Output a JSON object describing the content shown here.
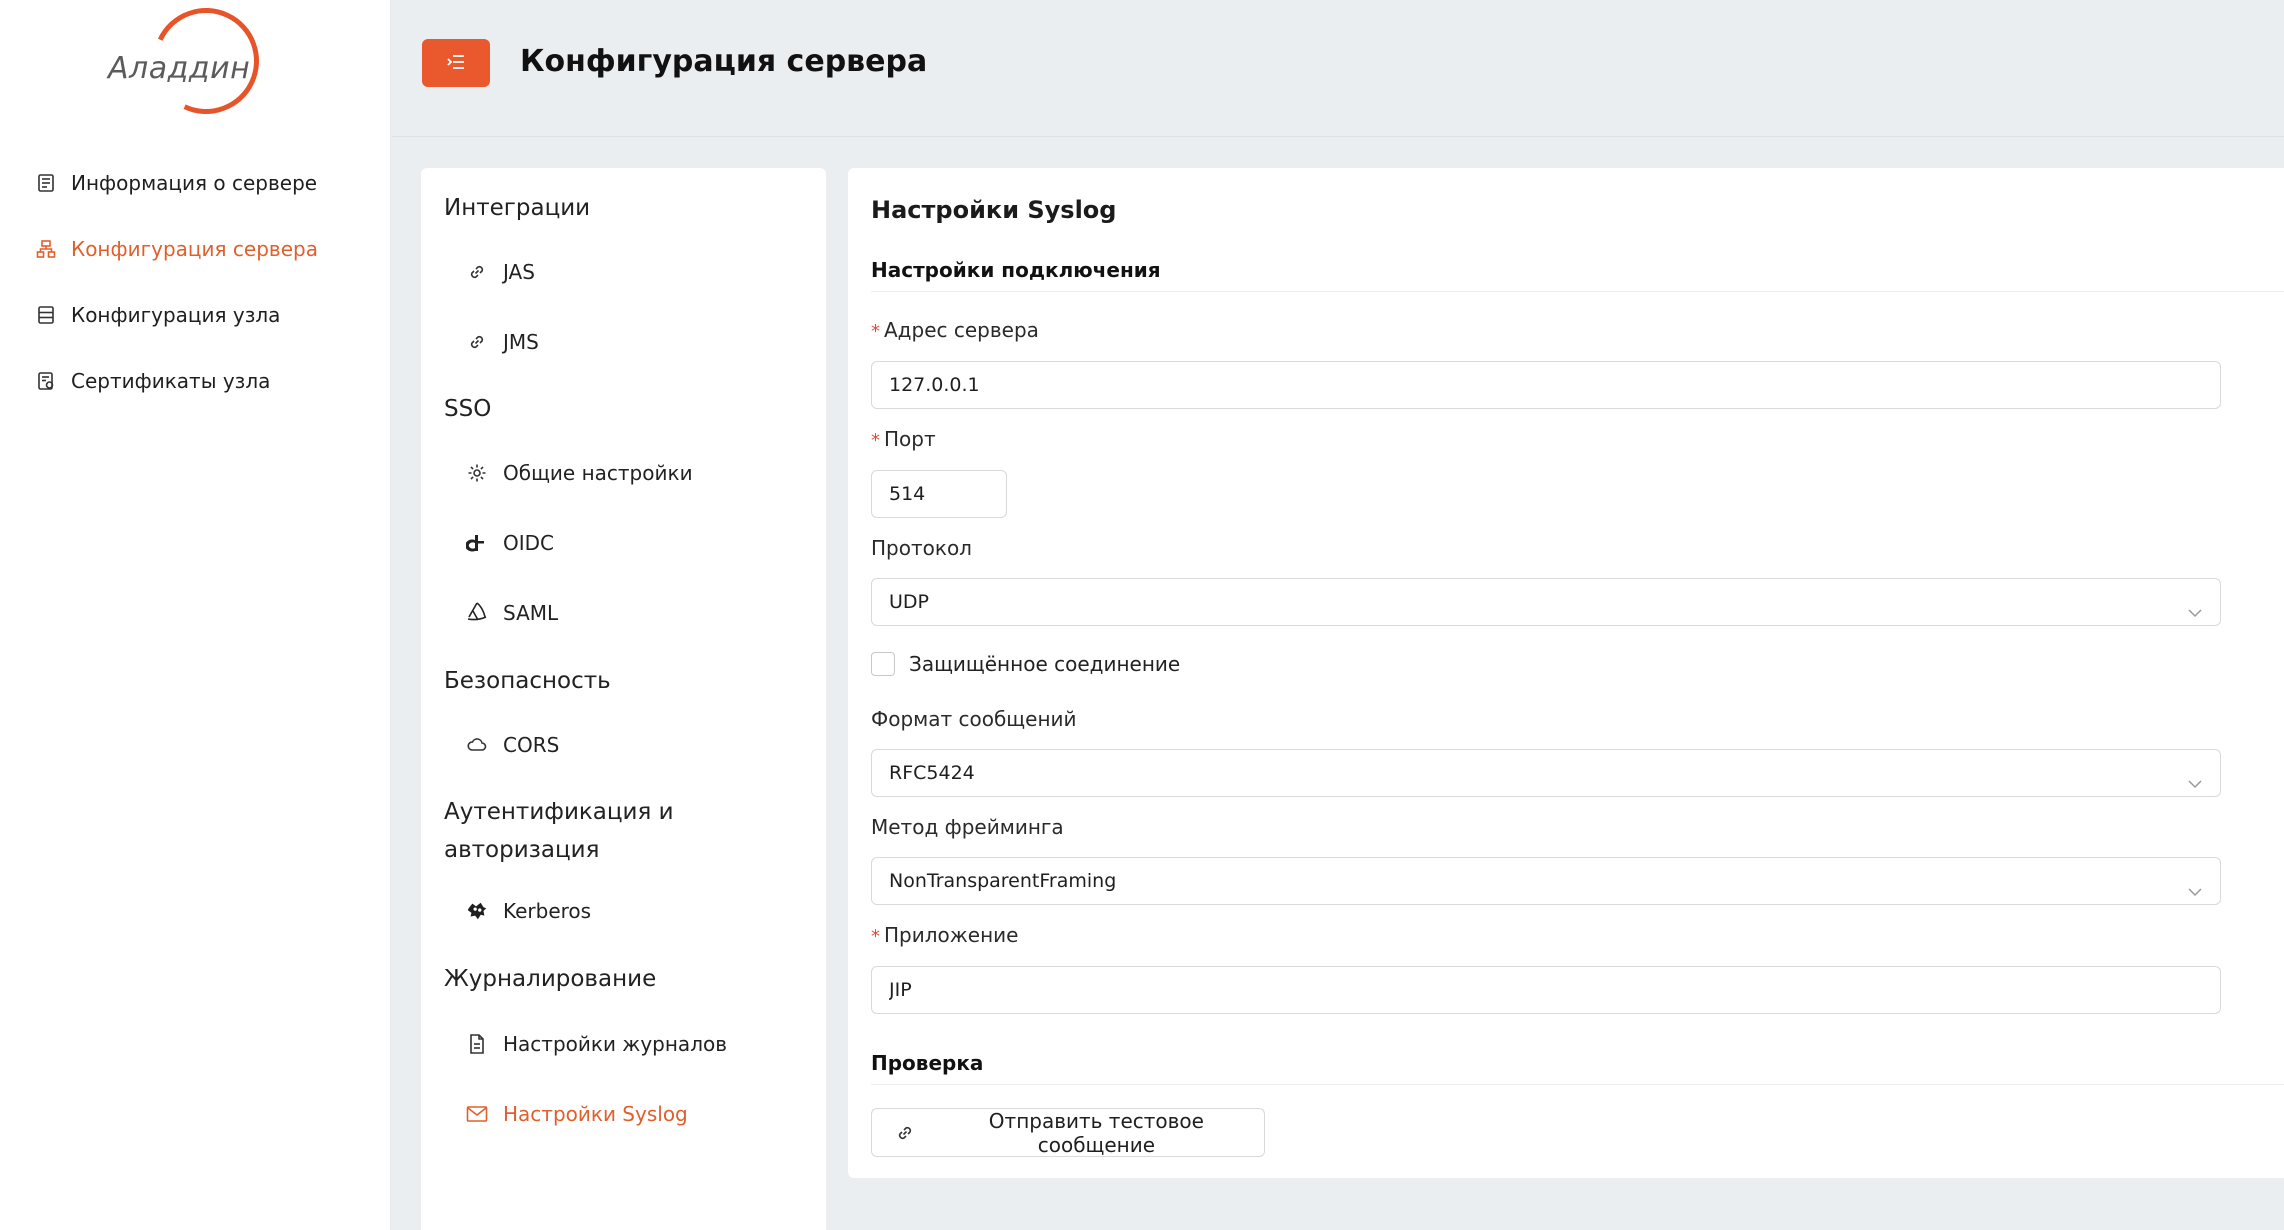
{
  "brand": {
    "logo_text": "Аладдин",
    "accent": "#e9592d"
  },
  "sidebar": {
    "items": [
      {
        "label": "Информация о сервере",
        "icon": "server-info-icon",
        "active": false
      },
      {
        "label": "Конфигурация сервера",
        "icon": "sitemap-icon",
        "active": true
      },
      {
        "label": "Конфигурация узла",
        "icon": "node-config-icon",
        "active": false
      },
      {
        "label": "Сертификаты узла",
        "icon": "certificate-icon",
        "active": false
      }
    ]
  },
  "header": {
    "title": "Конфигурация сервера",
    "menu_icon": "menu-fold-icon"
  },
  "settings_menu": {
    "groups": [
      {
        "title": "Интеграции",
        "items": [
          {
            "label": "JAS",
            "icon": "link-icon"
          },
          {
            "label": "JMS",
            "icon": "link-icon"
          }
        ]
      },
      {
        "title": "SSO",
        "items": [
          {
            "label": "Общие настройки",
            "icon": "gear-icon"
          },
          {
            "label": "OIDC",
            "icon": "oidc-icon"
          },
          {
            "label": "SAML",
            "icon": "saml-icon"
          }
        ]
      },
      {
        "title": "Безопасность",
        "items": [
          {
            "label": "CORS",
            "icon": "cloud-icon"
          }
        ]
      },
      {
        "title_line1": "Аутентификация и",
        "title_line2": "авторизация",
        "items": [
          {
            "label": "Kerberos",
            "icon": "kerberos-icon"
          }
        ]
      },
      {
        "title": "Журналирование",
        "items": [
          {
            "label": "Настройки журналов",
            "icon": "file-icon"
          },
          {
            "label": "Настройки Syslog",
            "icon": "mail-icon",
            "active": true
          }
        ]
      }
    ]
  },
  "form": {
    "card_title": "Настройки Syslog",
    "connection_section": "Настройки подключения",
    "server_address": {
      "label": "Адрес сервера",
      "required": true,
      "value": "127.0.0.1"
    },
    "port": {
      "label": "Порт",
      "required": true,
      "value": "514"
    },
    "protocol": {
      "label": "Протокол",
      "value": "UDP"
    },
    "secure_connection": {
      "label": "Защищённое соединение",
      "checked": false
    },
    "message_format": {
      "label": "Формат сообщений",
      "value": "RFC5424"
    },
    "framing_method": {
      "label": "Метод фрейминга",
      "value": "NonTransparentFraming"
    },
    "application": {
      "label": "Приложение",
      "required": true,
      "value": "JIP"
    },
    "check_section": "Проверка",
    "send_test_label": "Отправить тестовое сообщение"
  }
}
